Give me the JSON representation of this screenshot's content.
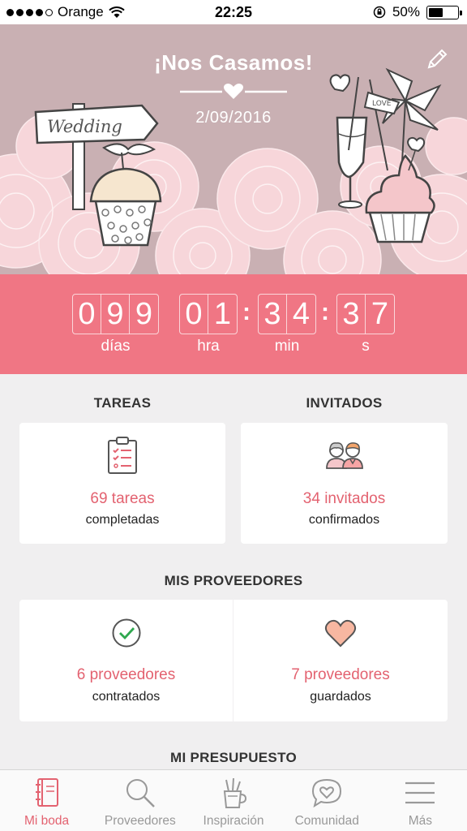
{
  "status_bar": {
    "carrier": "Orange",
    "time": "22:25",
    "battery": "50%"
  },
  "hero": {
    "title": "¡Nos Casamos!",
    "date": "2/09/2016",
    "sign_text": "Wedding",
    "flag_text": "LOVE"
  },
  "countdown": {
    "days": [
      "0",
      "9",
      "9"
    ],
    "hours": [
      "0",
      "1"
    ],
    "minutes": [
      "3",
      "4"
    ],
    "seconds": [
      "3",
      "7"
    ],
    "labels": {
      "days": "días",
      "hours": "hra",
      "minutes": "min",
      "seconds": "s"
    }
  },
  "tasks": {
    "title": "TAREAS",
    "value": "69 tareas",
    "subtitle": "completadas"
  },
  "guests": {
    "title": "INVITADOS",
    "value": "34 invitados",
    "subtitle": "confirmados"
  },
  "providers": {
    "title": "MIS PROVEEDORES",
    "hired": {
      "value": "6 proveedores",
      "subtitle": "contratados"
    },
    "saved": {
      "value": "7 proveedores",
      "subtitle": "guardados"
    }
  },
  "budget": {
    "title": "MI PRESUPUESTO"
  },
  "tabbar": {
    "items": [
      {
        "label": "Mi boda",
        "icon": "notebook-icon",
        "active": true
      },
      {
        "label": "Proveedores",
        "icon": "search-icon",
        "active": false
      },
      {
        "label": "Inspiración",
        "icon": "pencil-cup-icon",
        "active": false
      },
      {
        "label": "Comunidad",
        "icon": "heart-chat-icon",
        "active": false
      },
      {
        "label": "Más",
        "icon": "menu-icon",
        "active": false
      }
    ]
  },
  "colors": {
    "accent": "#f07684",
    "accent_text": "#e36270",
    "hero_bg": "#c9b0b3"
  }
}
